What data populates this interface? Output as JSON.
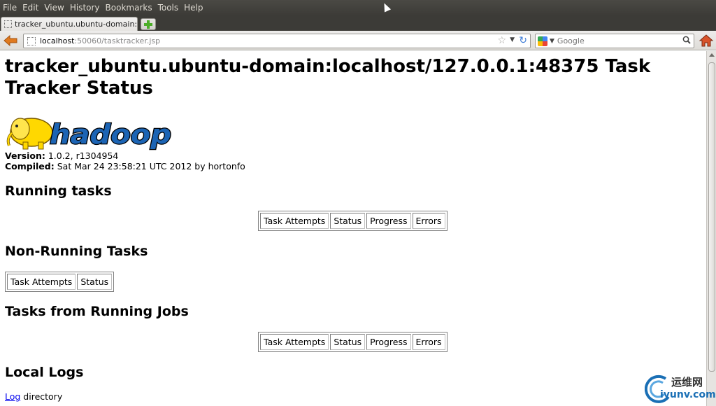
{
  "menu": {
    "items": [
      "File",
      "Edit",
      "View",
      "History",
      "Bookmarks",
      "Tools",
      "Help"
    ]
  },
  "tabs": [
    {
      "label": "tracker_ubuntu.ubuntu-domain:..."
    }
  ],
  "address_bar": {
    "host": "localhost",
    "rest": ":50060/tasktracker.jsp"
  },
  "search": {
    "placeholder": "Google"
  },
  "page": {
    "title": "tracker_ubuntu.ubuntu-domain:localhost/127.0.0.1:48375 Task Tracker Status",
    "logo_text": "hadoop",
    "version_label": "Version:",
    "version_value": "1.0.2, r1304954",
    "compiled_label": "Compiled:",
    "compiled_value": "Sat Mar 24 23:58:21 UTC 2012 by hortonfo",
    "sections": {
      "running": {
        "heading": "Running tasks",
        "columns": [
          "Task Attempts",
          "Status",
          "Progress",
          "Errors"
        ]
      },
      "non_running": {
        "heading": "Non-Running Tasks",
        "columns": [
          "Task Attempts",
          "Status"
        ]
      },
      "from_running_jobs": {
        "heading": "Tasks from Running Jobs",
        "columns": [
          "Task Attempts",
          "Status",
          "Progress",
          "Errors"
        ]
      },
      "local_logs": {
        "heading": "Local Logs",
        "link_text": "Log",
        "suffix": " directory"
      }
    }
  },
  "watermark": {
    "cn": "运维网",
    "url": "iyunv.com"
  },
  "colors": {
    "menubar": "#3c3b37",
    "link": "#0000ee",
    "logo_blue": "#1c64b4",
    "elephant_yellow": "#ffd800"
  }
}
